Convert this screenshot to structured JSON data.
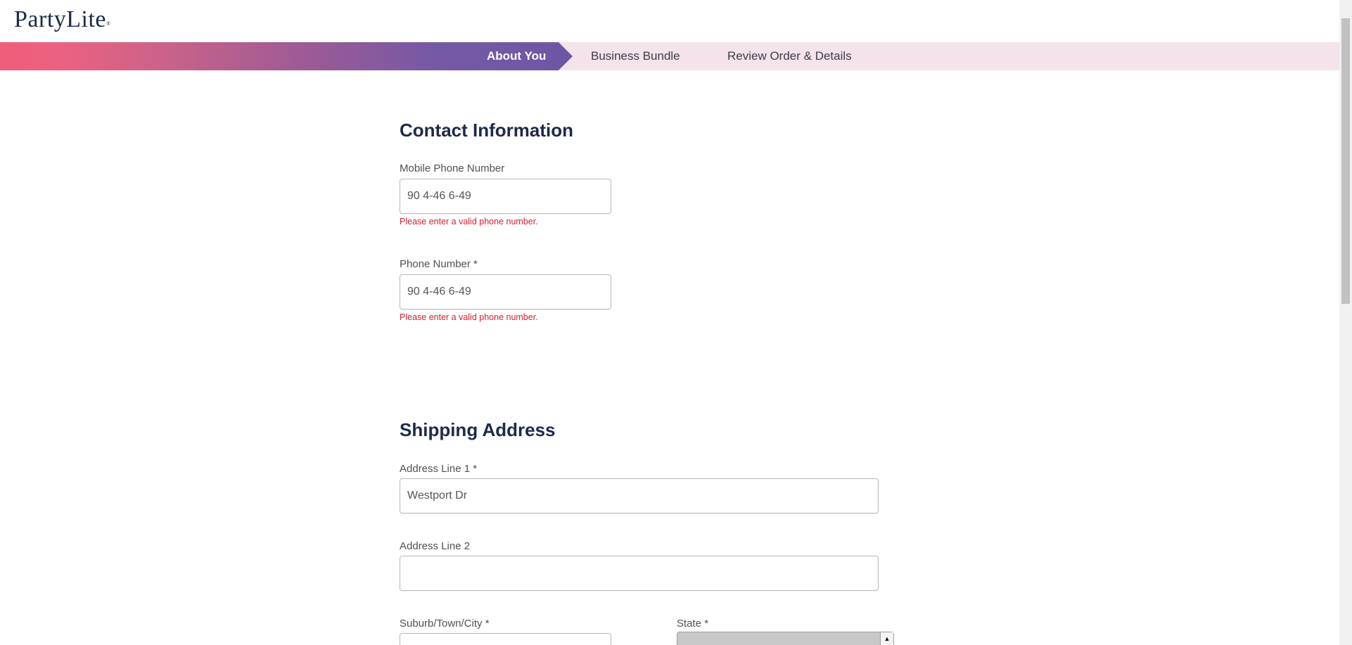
{
  "brand": {
    "logo_text": "PartyLite",
    "logo_mark": "®"
  },
  "progress": {
    "steps": [
      {
        "label": "About You",
        "active": true
      },
      {
        "label": "Business Bundle",
        "active": false
      },
      {
        "label": "Review Order & Details",
        "active": false
      }
    ]
  },
  "contact": {
    "title": "Contact Information",
    "mobile_label": "Mobile Phone Number",
    "mobile_value": "90 4-46 6-49",
    "mobile_error": "Please enter a valid phone number.",
    "phone_label": "Phone Number *",
    "phone_value": "90 4-46 6-49",
    "phone_error": "Please enter a valid phone number."
  },
  "shipping": {
    "title": "Shipping Address",
    "address1_label": "Address Line 1 *",
    "address1_value": "Westport Dr",
    "address2_label": "Address Line 2",
    "address2_value": "",
    "city_label": "Suburb/Town/City *",
    "city_value": "",
    "state_label": "State *"
  },
  "colors": {
    "accent_pink": "#ef5d7a",
    "accent_purple": "#6e56a4",
    "stepper_bg": "#f4e3ea",
    "heading": "#1c2a4a",
    "error": "#d2202e"
  },
  "icons": {
    "state_spinner": "triangle-up-icon"
  }
}
